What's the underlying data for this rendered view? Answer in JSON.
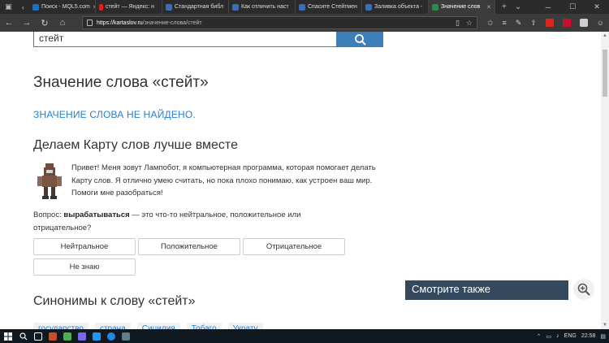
{
  "browser": {
    "tabs": [
      {
        "label": "Поиск - MQL5.com",
        "color": "#1e73be",
        "active": false
      },
      {
        "label": "стейт — Яндекс: н",
        "color": "#e02020",
        "active": false
      },
      {
        "label": "Стандартная библ",
        "color": "#3a6fb5",
        "active": false
      },
      {
        "label": "Как отличить наст",
        "color": "#3a6fb5",
        "active": false
      },
      {
        "label": "Спасите Стейтмен",
        "color": "#3a6fb5",
        "active": false
      },
      {
        "label": "Заливка объекта -",
        "color": "#3a6fb5",
        "active": false
      },
      {
        "label": "Значение слов",
        "color": "#2d8a4e",
        "active": true
      }
    ],
    "url_host": "https://kartaslov.ru",
    "url_path": "/значение-слова/стейт"
  },
  "page": {
    "search_value": "стейт",
    "title": "Значение слова «стейт»",
    "not_found": "ЗНАЧЕНИЕ СЛОВА НЕ НАЙДЕНО.",
    "map_heading": "Делаем Карту слов лучше вместе",
    "intro": "Привет! Меня зовут Лампобот, я компьютерная программа, которая помогает делать Карту слов. Я отлично умею считать, но пока плохо понимаю, как устроен ваш мир. Помоги мне разобраться!",
    "question_prefix": "Вопрос: ",
    "question_word": "вырабатываться",
    "question_suffix": " — это что-то нейтральное, положительное или отрицательное?",
    "answers": {
      "neutral": "Нейтральное",
      "positive": "Положительное",
      "negative": "Отрицательное",
      "unknown": "Не знаю"
    },
    "synonyms_heading": "Синонимы к слову «стейт»",
    "synonyms": [
      "государство",
      "страна",
      "Сицилия",
      "Тобаго",
      "Украту"
    ],
    "see_also": "Смотрите также"
  },
  "taskbar": {
    "lang": "ENG",
    "time": "22:58"
  },
  "colors": {
    "accent": "#3d7fb8",
    "link": "#2a7fc7",
    "see_also_bg": "#35495e"
  }
}
